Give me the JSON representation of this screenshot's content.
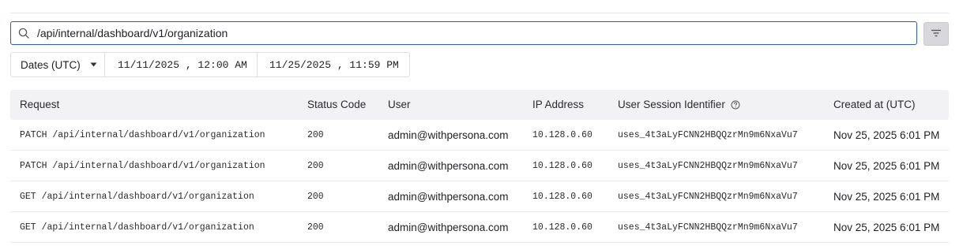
{
  "search": {
    "value": "/api/internal/dashboard/v1/organization"
  },
  "dates": {
    "mode_label": "Dates (UTC)",
    "from": "11/11/2025 , 12:00 AM",
    "to": "11/25/2025 , 11:59 PM"
  },
  "table": {
    "headers": {
      "request": "Request",
      "status": "Status Code",
      "user": "User",
      "ip": "IP Address",
      "session": "User Session Identifier",
      "created": "Created at (UTC)"
    },
    "rows": [
      {
        "request": "PATCH /api/internal/dashboard/v1/organization",
        "status": "200",
        "user": "admin@withpersona.com",
        "ip": "10.128.0.60",
        "session": "uses_4t3aLyFCNN2HBQQzrMn9m6NxaVu7",
        "created": "Nov 25, 2025 6:01 PM"
      },
      {
        "request": "PATCH /api/internal/dashboard/v1/organization",
        "status": "200",
        "user": "admin@withpersona.com",
        "ip": "10.128.0.60",
        "session": "uses_4t3aLyFCNN2HBQQzrMn9m6NxaVu7",
        "created": "Nov 25, 2025 6:01 PM"
      },
      {
        "request": "GET /api/internal/dashboard/v1/organization",
        "status": "200",
        "user": "admin@withpersona.com",
        "ip": "10.128.0.60",
        "session": "uses_4t3aLyFCNN2HBQQzrMn9m6NxaVu7",
        "created": "Nov 25, 2025 6:01 PM"
      },
      {
        "request": "GET /api/internal/dashboard/v1/organization",
        "status": "200",
        "user": "admin@withpersona.com",
        "ip": "10.128.0.60",
        "session": "uses_4t3aLyFCNN2HBQQzrMn9m6NxaVu7",
        "created": "Nov 25, 2025 6:01 PM"
      }
    ]
  }
}
